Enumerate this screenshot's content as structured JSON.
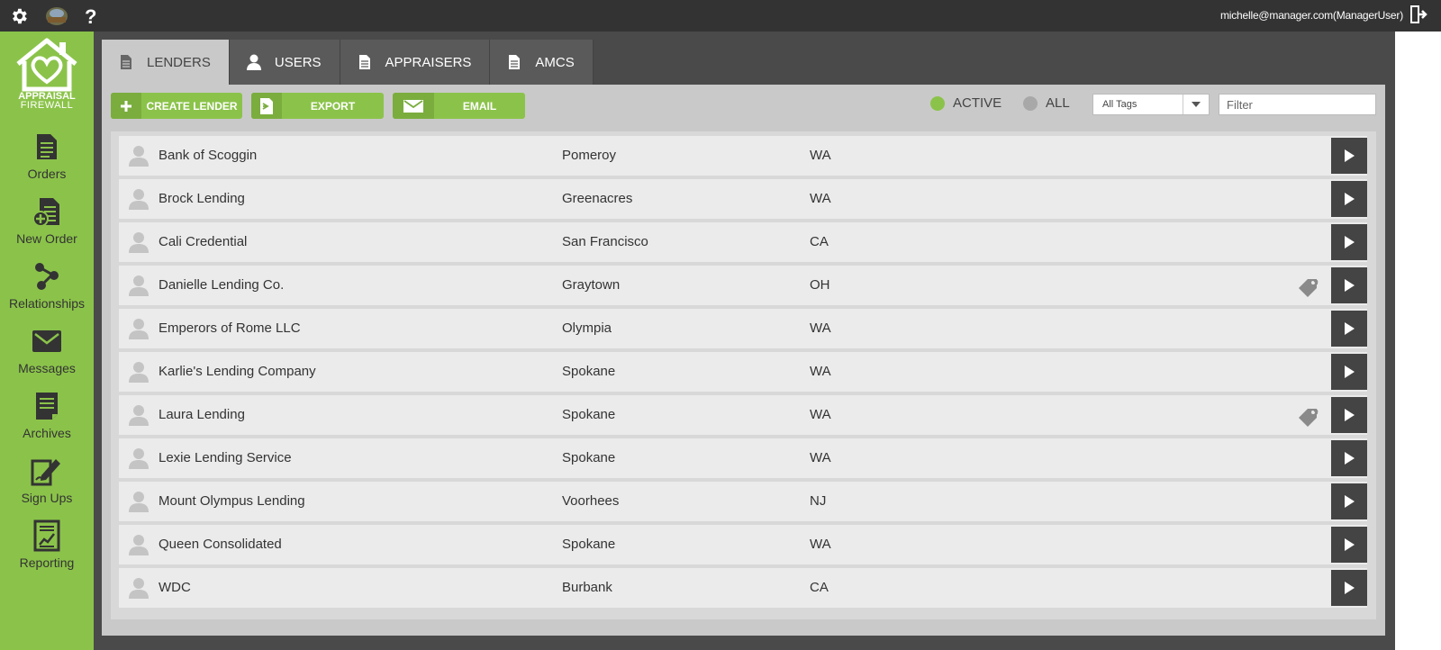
{
  "topbar": {
    "user_email": "michelle@manager.com(ManagerUser)",
    "icons": [
      "gear-icon",
      "profile-photo",
      "help-icon",
      "logout-icon"
    ]
  },
  "brand": {
    "line1": "APPRAISAL",
    "line2": "FIREWALL",
    "accent_color": "#8bc34a"
  },
  "sidebar": {
    "items": [
      {
        "label": "Orders",
        "icon": "document-icon"
      },
      {
        "label": "New Order",
        "icon": "new-order-icon"
      },
      {
        "label": "Relationships",
        "icon": "relationships-icon"
      },
      {
        "label": "Messages",
        "icon": "envelope-icon"
      },
      {
        "label": "Archives",
        "icon": "archive-icon"
      },
      {
        "label": "Sign Ups",
        "icon": "sign-up-icon"
      },
      {
        "label": "Reporting",
        "icon": "report-icon"
      }
    ]
  },
  "tabs": [
    {
      "label": "LENDERS",
      "icon": "document-icon",
      "active": true
    },
    {
      "label": "USERS",
      "icon": "user-icon",
      "active": false
    },
    {
      "label": "APPRAISERS",
      "icon": "document-icon",
      "active": false
    },
    {
      "label": "AMCS",
      "icon": "document-icon",
      "active": false
    }
  ],
  "toolbar": {
    "create_label": "CREATE LENDER",
    "export_label": "EXPORT",
    "email_label": "EMAIL",
    "active_label": "ACTIVE",
    "all_label": "ALL",
    "tags_selected": "All Tags",
    "filter_placeholder": "Filter"
  },
  "lenders": [
    {
      "name": "Bank of Scoggin",
      "city": "Pomeroy",
      "state": "WA",
      "tagged": false
    },
    {
      "name": "Brock Lending",
      "city": "Greenacres",
      "state": "WA",
      "tagged": false
    },
    {
      "name": "Cali Credential",
      "city": "San Francisco",
      "state": "CA",
      "tagged": false
    },
    {
      "name": "Danielle Lending Co.",
      "city": "Graytown",
      "state": "OH",
      "tagged": true
    },
    {
      "name": "Emperors of Rome LLC",
      "city": "Olympia",
      "state": "WA",
      "tagged": false
    },
    {
      "name": "Karlie's Lending Company",
      "city": "Spokane",
      "state": "WA",
      "tagged": false
    },
    {
      "name": "Laura Lending",
      "city": "Spokane",
      "state": "WA",
      "tagged": true
    },
    {
      "name": "Lexie Lending Service",
      "city": "Spokane",
      "state": "WA",
      "tagged": false
    },
    {
      "name": "Mount Olympus Lending",
      "city": "Voorhees",
      "state": "NJ",
      "tagged": false
    },
    {
      "name": "Queen Consolidated",
      "city": "Spokane",
      "state": "WA",
      "tagged": false
    },
    {
      "name": "WDC",
      "city": "Burbank",
      "state": "CA",
      "tagged": false
    }
  ]
}
